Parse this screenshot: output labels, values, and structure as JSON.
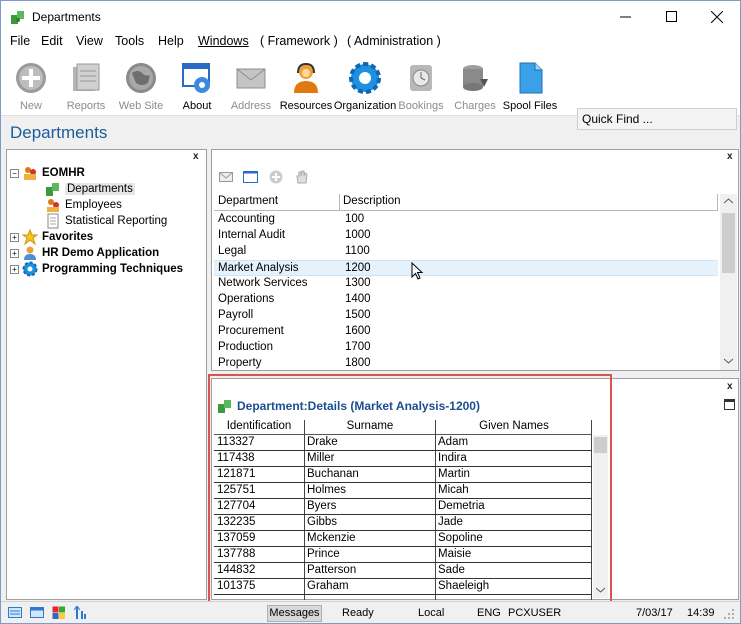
{
  "window": {
    "title": "Departments",
    "minimize": "—",
    "maximize": "☐",
    "close": "✕"
  },
  "menu": [
    "File",
    "Edit",
    "View",
    "Tools",
    "Help",
    "Windows",
    "( Framework )",
    "( Administration )"
  ],
  "toolbar": {
    "buttons": [
      {
        "label": "New",
        "icon": "plus-circle-icon",
        "enabled": false
      },
      {
        "label": "Reports",
        "icon": "folder-icon",
        "enabled": false
      },
      {
        "label": "Web Site",
        "icon": "globe-icon",
        "enabled": false
      },
      {
        "label": "About",
        "icon": "gear-window-icon",
        "enabled": true
      },
      {
        "label": "Address",
        "icon": "envelope-icon",
        "enabled": false
      },
      {
        "label": "Resources",
        "icon": "person-headset-icon",
        "enabled": true
      },
      {
        "label": "Organization",
        "icon": "gear-icon",
        "enabled": true
      },
      {
        "label": "Bookings",
        "icon": "clock-icon",
        "enabled": false
      },
      {
        "label": "Charges",
        "icon": "coins-icon",
        "enabled": false
      },
      {
        "label": "Spool Files",
        "icon": "document-icon",
        "enabled": true
      }
    ],
    "quick_find": "Quick Find ..."
  },
  "page_title": "Departments",
  "tree": {
    "close": "x",
    "items": [
      {
        "label": "EOMHR",
        "bold": true,
        "expander": "−"
      },
      {
        "label": "Departments",
        "bold": false,
        "selected": true
      },
      {
        "label": "Employees",
        "bold": false
      },
      {
        "label": "Statistical Reporting",
        "bold": false
      },
      {
        "label": "Favorites",
        "bold": true,
        "expander": "+"
      },
      {
        "label": "HR Demo Application",
        "bold": true,
        "expander": "+"
      },
      {
        "label": "Programming Techniques",
        "bold": true,
        "expander": "+"
      }
    ]
  },
  "dept_list": {
    "close": "x",
    "columns": [
      "Department",
      "Description"
    ],
    "rows": [
      [
        "Accounting",
        "100"
      ],
      [
        "Internal Audit",
        "1000"
      ],
      [
        "Legal",
        "1100"
      ],
      [
        "Market Analysis",
        "1200"
      ],
      [
        "Network Services",
        "1300"
      ],
      [
        "Operations",
        "1400"
      ],
      [
        "Payroll",
        "1500"
      ],
      [
        "Procurement",
        "1600"
      ],
      [
        "Production",
        "1700"
      ],
      [
        "Property",
        "1800"
      ]
    ],
    "selected_row": 3
  },
  "details": {
    "close": "x",
    "title": "Department:Details (Market Analysis-1200)",
    "columns": [
      "Identification",
      "Surname",
      "Given Names"
    ],
    "rows": [
      [
        "113327",
        "Drake",
        "Adam"
      ],
      [
        "117438",
        "Miller",
        "Indira"
      ],
      [
        "121871",
        "Buchanan",
        "Martin"
      ],
      [
        "125751",
        "Holmes",
        "Micah"
      ],
      [
        "127704",
        "Byers",
        "Demetria"
      ],
      [
        "132235",
        "Gibbs",
        "Jade"
      ],
      [
        "137059",
        "Mckenzie",
        "Sopoline"
      ],
      [
        "137788",
        "Prince",
        "Maisie"
      ],
      [
        "144832",
        "Patterson",
        "Sade"
      ],
      [
        "101375",
        "Graham",
        "Shaeleigh"
      ]
    ]
  },
  "status": {
    "messages": "Messages",
    "state": "Ready",
    "location": "Local",
    "language": "ENG",
    "user": "PCXUSER",
    "date": "7/03/17",
    "time": "14:39"
  },
  "colors": {
    "accent": "#1c5b9c",
    "frame_red": "#d9534f",
    "selection": "#e5f1fb"
  }
}
